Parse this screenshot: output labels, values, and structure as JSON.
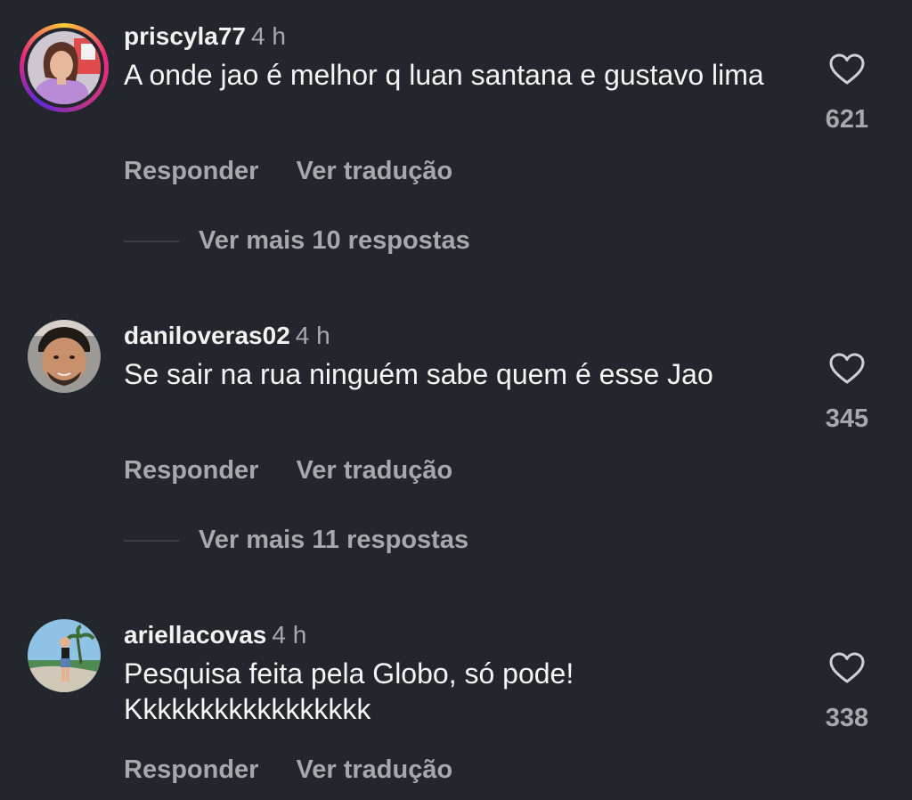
{
  "comments": [
    {
      "username": "priscyla77",
      "time": "4 h",
      "text": "A onde jao é melhor q luan santana e gustavo lima",
      "likes": "621",
      "reply_label": "Responder",
      "translate_label": "Ver tradução",
      "more_replies": "Ver mais 10 respostas",
      "avatar_ring": true
    },
    {
      "username": "daniloveras02",
      "time": "4 h",
      "text": "Se sair na rua ninguém sabe quem é esse Jao",
      "likes": "345",
      "reply_label": "Responder",
      "translate_label": "Ver tradução",
      "more_replies": "Ver mais 11 respostas",
      "avatar_ring": false
    },
    {
      "username": "ariellacovas",
      "time": "4 h",
      "text": "Pesquisa feita pela Globo, só pode! Kkkkkkkkkkkkkkkkk",
      "likes": "338",
      "reply_label": "Responder",
      "translate_label": "Ver tradução",
      "avatar_ring": false
    }
  ],
  "icons": {
    "like": "heart-outline-icon"
  },
  "colors": {
    "background": "#23262c",
    "primary_text": "#f2f2f2",
    "secondary_text": "#a7a8ac",
    "story_ring": [
      "#f9ce34",
      "#ee2a7b",
      "#6228d7"
    ]
  }
}
